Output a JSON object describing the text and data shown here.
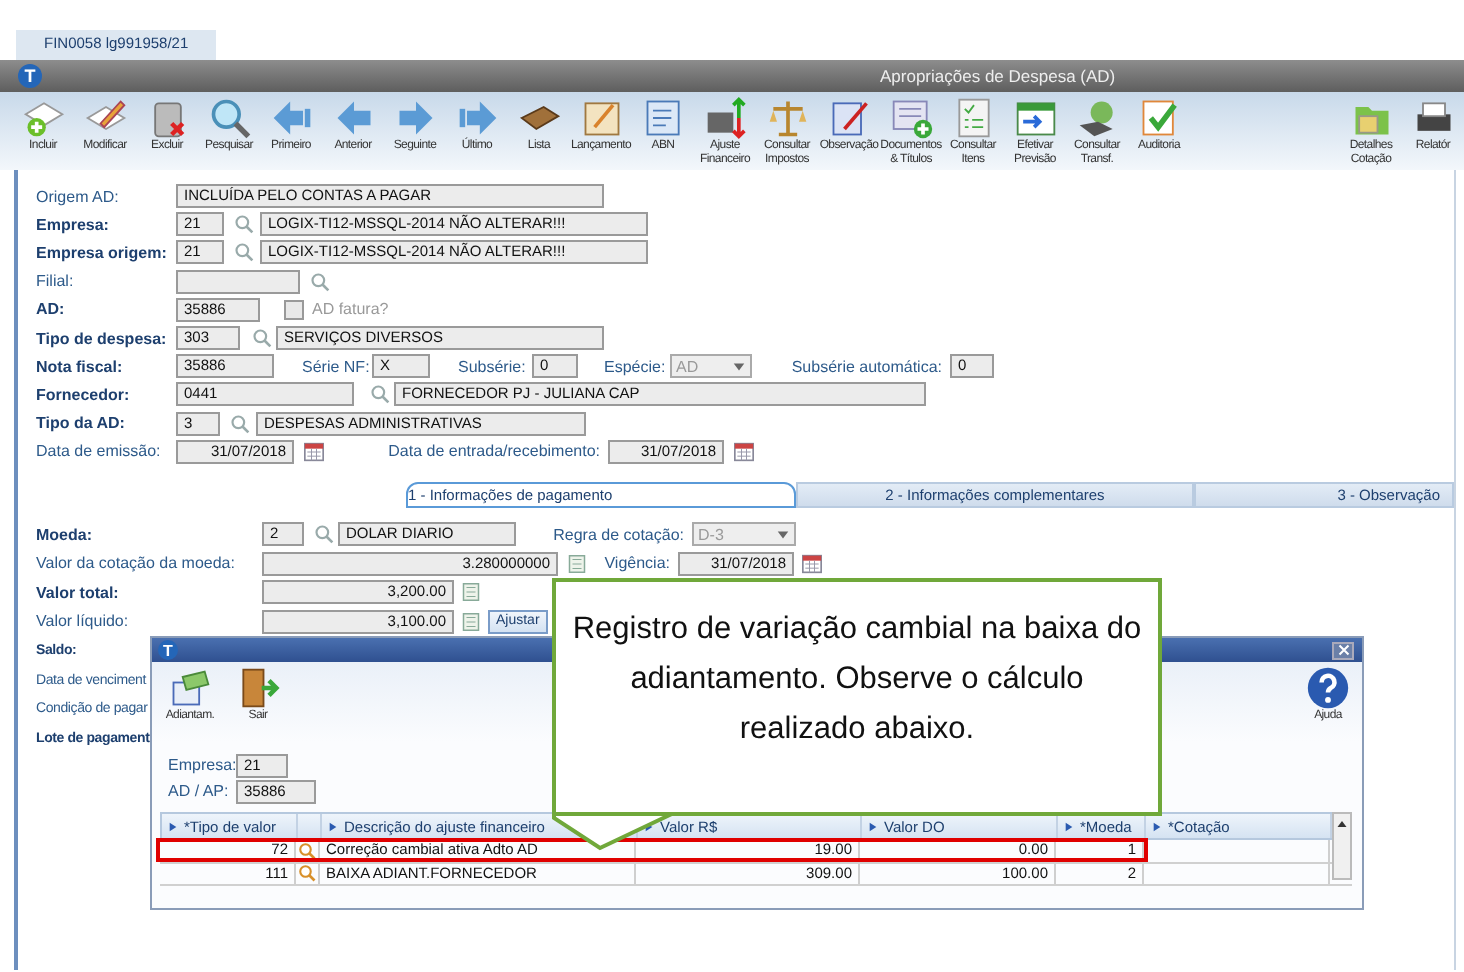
{
  "program_tab": "FIN0058 lg991958/21",
  "window": {
    "logo": "T",
    "title": "Apropriações de Despesa (AD)"
  },
  "toolbar": [
    {
      "label": "Incluir"
    },
    {
      "label": "Modificar"
    },
    {
      "label": "Excluir"
    },
    {
      "label": "Pesquisar"
    },
    {
      "label": "Primeiro"
    },
    {
      "label": "Anterior"
    },
    {
      "label": "Seguinte"
    },
    {
      "label": "Último"
    },
    {
      "label": "Lista"
    },
    {
      "label": "Lançamento"
    },
    {
      "label": "ABN"
    },
    {
      "label": "Ajuste Financeiro"
    },
    {
      "label": "Consultar Impostos"
    },
    {
      "label": "Observação"
    },
    {
      "label": "Documentos & Títulos"
    },
    {
      "label": "Consultar Itens"
    },
    {
      "label": "Efetivar Previsão"
    },
    {
      "label": "Consultar Transf."
    },
    {
      "label": "Auditoria"
    },
    {
      "label": "Detalhes Cotação"
    },
    {
      "label": "Relatór"
    }
  ],
  "form": [
    {
      "label": "Origem AD:",
      "required": false,
      "fields": [
        {
          "kind": "text",
          "value": "INCLUÍDA PELO CONTAS A PAGAR"
        }
      ]
    },
    {
      "label": "Empresa:",
      "required": true,
      "fields": [
        {
          "kind": "text",
          "value": "21"
        },
        {
          "kind": "lookup"
        },
        {
          "kind": "text",
          "value": "LOGIX-TI12-MSSQL-2014 NÃO ALTERAR!!!"
        }
      ]
    },
    {
      "label": "Empresa origem:",
      "required": true,
      "fields": [
        {
          "kind": "text",
          "value": "21"
        },
        {
          "kind": "lookup"
        },
        {
          "kind": "text",
          "value": "LOGIX-TI12-MSSQL-2014 NÃO ALTERAR!!!"
        }
      ]
    },
    {
      "label": "Filial:",
      "required": false,
      "fields": [
        {
          "kind": "text"
        },
        {
          "kind": "lookup"
        }
      ]
    },
    {
      "label": "AD:",
      "required": true,
      "fields": [
        {
          "kind": "text",
          "value": "35886"
        },
        {
          "kind": "checkbox",
          "checked": false,
          "label": "AD fatura?"
        }
      ]
    },
    {
      "label": "Tipo de despesa:",
      "required": true,
      "fields": [
        {
          "kind": "text",
          "value": "303"
        },
        {
          "kind": "lookup"
        },
        {
          "kind": "text",
          "value": "SERVIÇOS DIVERSOS"
        }
      ]
    },
    {
      "label": "Nota fiscal:",
      "required": true,
      "fields": [
        {
          "kind": "text",
          "value": "35886"
        },
        {
          "kind": "label",
          "value": "Série NF:"
        },
        {
          "kind": "text",
          "value": "X"
        },
        {
          "kind": "label",
          "value": "Subsérie:"
        },
        {
          "kind": "text",
          "value": "0"
        },
        {
          "kind": "label",
          "value": "Espécie:"
        },
        {
          "kind": "select",
          "value": "AD",
          "disabled": true
        },
        {
          "kind": "label",
          "value": "Subsérie automática:"
        },
        {
          "kind": "text",
          "value": "0"
        }
      ]
    },
    {
      "label": "Fornecedor:",
      "required": true,
      "fields": [
        {
          "kind": "text",
          "value": "0441"
        },
        {
          "kind": "lookup"
        },
        {
          "kind": "text",
          "value": "FORNECEDOR PJ - JULIANA CAP"
        }
      ]
    },
    {
      "label": "Tipo da AD:",
      "required": true,
      "fields": [
        {
          "kind": "text",
          "value": "3"
        },
        {
          "kind": "lookup"
        },
        {
          "kind": "text",
          "value": "DESPESAS ADMINISTRATIVAS"
        }
      ]
    },
    {
      "label": "Data de emissão:",
      "required": false,
      "fields": [
        {
          "kind": "number",
          "value": "31/07/2018"
        },
        {
          "kind": "calendar"
        },
        {
          "kind": "label",
          "value": "Data de entrada/recebimento:"
        },
        {
          "kind": "number",
          "value": "31/07/2018"
        },
        {
          "kind": "calendar"
        }
      ]
    }
  ],
  "tabs": [
    {
      "label": "1 - Informações de pagamento",
      "selected": true
    },
    {
      "label": "2 - Informações complementares",
      "selected": false
    },
    {
      "label": "3 - Observação",
      "selected": false
    }
  ],
  "payment": [
    {
      "label": "Moeda:",
      "required": true,
      "fields": [
        {
          "kind": "text",
          "value": "2"
        },
        {
          "kind": "lookup"
        },
        {
          "kind": "text",
          "value": "DOLAR DIARIO"
        },
        {
          "kind": "label",
          "value": "Regra de cotação:"
        },
        {
          "kind": "select",
          "value": "D-3",
          "disabled": true
        }
      ]
    },
    {
      "label": "Valor da cotação da moeda:",
      "required": false,
      "fields": [
        {
          "kind": "number",
          "value": "3.280000000"
        },
        {
          "kind": "calculator"
        },
        {
          "kind": "label",
          "value": "Vigência:"
        },
        {
          "kind": "number",
          "value": "31/07/2018"
        },
        {
          "kind": "calendar"
        }
      ]
    },
    {
      "label": "Valor total:",
      "required": true,
      "fields": [
        {
          "kind": "number",
          "value": "3,200.00"
        },
        {
          "kind": "calculator"
        }
      ]
    },
    {
      "label": "Valor líquido:",
      "required": false,
      "fields": [
        {
          "kind": "number",
          "value": "3,100.00"
        },
        {
          "kind": "calculator"
        },
        {
          "kind": "button",
          "value": "Ajustar"
        }
      ]
    },
    {
      "label": "Saldo:",
      "required": true
    },
    {
      "label": "Data de venciment",
      "required": false
    },
    {
      "label": "Condição de pagar",
      "required": false
    },
    {
      "label": "Lote de pagament",
      "required": true
    }
  ],
  "dialog": {
    "logo": "T",
    "toolbar": [
      {
        "label": "Adiantam."
      },
      {
        "label": "Sair"
      }
    ],
    "help": "Ajuda",
    "fields": [
      {
        "label": "Empresa:",
        "value": "21"
      },
      {
        "label": "AD / AP:",
        "value": "35886"
      }
    ],
    "table": {
      "columns": [
        "*Tipo de valor",
        "Descrição do ajuste financeiro",
        "Valor R$",
        "Valor DO",
        "*Moeda",
        "*Cotação"
      ],
      "rows": [
        {
          "tipo": "72",
          "descricao": "Correção cambial ativa Adto AD",
          "valor_rs": "19.00",
          "valor_do": "0.00",
          "moeda": "1",
          "highlighted": true
        },
        {
          "tipo": "111",
          "descricao": "BAIXA ADIANT.FORNECEDOR",
          "valor_rs": "309.00",
          "valor_do": "100.00",
          "moeda": "2",
          "highlighted": false
        }
      ]
    }
  },
  "callout": {
    "text": "Registro de variação cambial na baixa do adiantamento. Observe o cálculo realizado abaixo."
  }
}
